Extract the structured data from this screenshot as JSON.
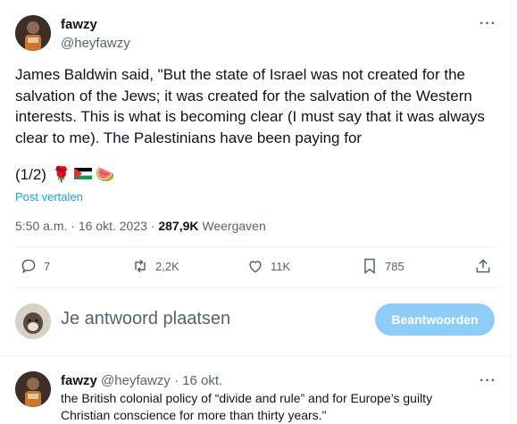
{
  "main_tweet": {
    "author_name": "fawzy",
    "author_handle": "@heyfawzy",
    "more_label": "···",
    "text": "James Baldwin said, \"But the state of Israel was not created for the salvation of the Jews; it was created for the salvation of the Western interests. This is what is becoming clear (I must say that it was always clear to me). The Palestinians have been paying for",
    "part_label": "(1/2)",
    "emojis": [
      "🌹",
      "🇵🇸",
      "🍉"
    ],
    "translate_label": "Post vertalen",
    "time": "5:50 a.m.",
    "separator": "·",
    "date": "16 okt. 2023",
    "views_count": "287,9K",
    "views_label": "Weergaven"
  },
  "actions": {
    "replies": "7",
    "reposts": "2,2K",
    "likes": "11K",
    "bookmarks": "785"
  },
  "reply_composer": {
    "placeholder": "Je antwoord plaatsen",
    "button_label": "Beantwoorden"
  },
  "reply_tweet": {
    "author_name": "fawzy",
    "author_handle": "@heyfawzy",
    "separator": "·",
    "date": "16 okt.",
    "more_label": "···",
    "text": "the British colonial policy of “divide and rule” and for Europe’s guilty Christian conscience for more than thirty years.\""
  },
  "colors": {
    "accent": "#1d9bf0",
    "button_disabled": "#8ecdf7",
    "secondary_text": "#536471"
  }
}
